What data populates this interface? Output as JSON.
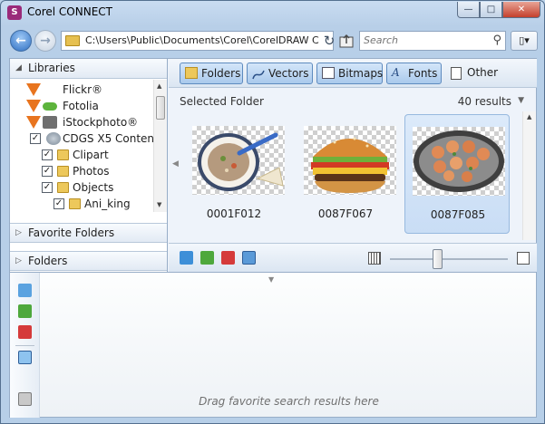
{
  "window": {
    "title": "Corel CONNECT",
    "app_icon": "corel-connect-icon"
  },
  "nav": {
    "address": "C:\\Users\\Public\\Documents\\Corel\\CorelDRAW C",
    "search_placeholder": "Search",
    "menu_label": "▯▾"
  },
  "libraries": {
    "title": "Libraries",
    "items": [
      {
        "label": "Flickr®",
        "icon": "vector-v-icon"
      },
      {
        "label": "Fotolia",
        "icon": "fotolia-icon"
      },
      {
        "label": "iStockphoto®",
        "icon": "istockphoto-icon"
      },
      {
        "label": "CDGS X5 Content",
        "icon": "cd-icon",
        "checked": true
      },
      {
        "label": "Clipart",
        "icon": "folder-icon",
        "checked": true
      },
      {
        "label": "Photos",
        "icon": "folder-icon",
        "checked": true
      },
      {
        "label": "Objects",
        "icon": "folder-icon",
        "checked": true
      },
      {
        "label": "Ani_king",
        "icon": "folder-icon",
        "checked": true
      }
    ]
  },
  "favorite_folders": {
    "title": "Favorite Folders"
  },
  "folders": {
    "title": "Folders"
  },
  "toolbar": {
    "folders": "Folders",
    "vectors": "Vectors",
    "bitmaps": "Bitmaps",
    "fonts": "Fonts",
    "other": "Other"
  },
  "content": {
    "heading": "Selected Folder",
    "results": "40 results",
    "items": [
      {
        "label": "0001F012",
        "subject": "bowl of soup"
      },
      {
        "label": "0087F067",
        "subject": "hamburger"
      },
      {
        "label": "0087F085",
        "subject": "platter of shrimp",
        "selected": true
      }
    ]
  },
  "tray": {
    "hint": "Drag favorite search results here"
  },
  "colors": {
    "selected_bg": "#dceafa",
    "toolbar_active": "#a9c9ec",
    "chrome": "#bcd3ea"
  }
}
